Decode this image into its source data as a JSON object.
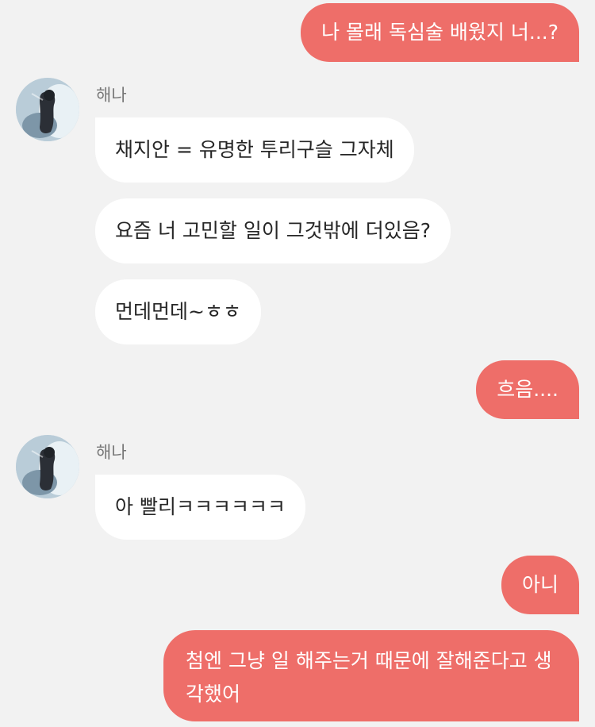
{
  "colors": {
    "background": "#f2f2f2",
    "outgoing_bubble": "#ee6e69",
    "incoming_bubble": "#ffffff",
    "sender_name": "#777777"
  },
  "messages": [
    {
      "from": "me",
      "text": "나 몰래 독심술 배웠지 너...?"
    },
    {
      "from": "them",
      "sender": "해나",
      "avatar_icon": "profile-photo-icon",
      "text": "채지안 = 유명한 투리구슬 그자체"
    },
    {
      "from": "them",
      "text": "요즘 너 고민할 일이 그것밖에 더있음?"
    },
    {
      "from": "them",
      "text": "먼데먼데~ㅎㅎ"
    },
    {
      "from": "me",
      "text": "흐음...."
    },
    {
      "from": "them",
      "sender": "해나",
      "avatar_icon": "profile-photo-icon",
      "text": "아 빨리ㅋㅋㅋㅋㅋㅋ"
    },
    {
      "from": "me",
      "text": "아니"
    },
    {
      "from": "me",
      "text": "첨엔 그냥 일 해주는거 때문에 잘해준다고 생각했어"
    }
  ]
}
